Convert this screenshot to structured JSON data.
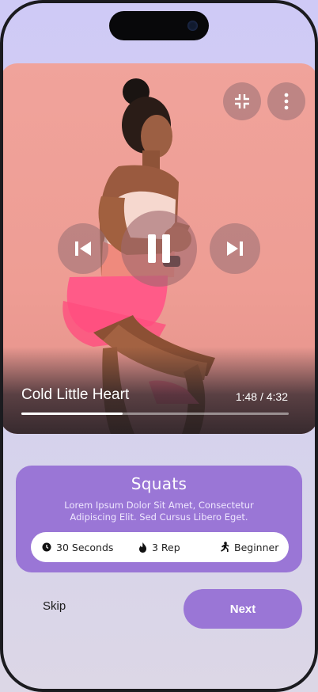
{
  "player": {
    "track_title": "Cold Little Heart",
    "time": "1:48 / 4:32",
    "progress": 0.38,
    "controls": {
      "minimize_icon": "minimize-icon",
      "more_icon": "more-vertical-icon",
      "previous_icon": "skip-previous-icon",
      "pause_icon": "pause-icon",
      "next_icon": "skip-next-icon"
    }
  },
  "exercise": {
    "title": "Squats",
    "description": "Lorem Ipsum Dolor Sit Amet, Consectetur Adipiscing Elit. Sed Cursus Libero Eget.",
    "stats": [
      {
        "icon": "clock-icon",
        "label": "30 Seconds"
      },
      {
        "icon": "flame-icon",
        "label": "3 Rep"
      },
      {
        "icon": "running-icon",
        "label": "Beginner"
      }
    ]
  },
  "actions": {
    "skip_label": "Skip",
    "next_label": "Next"
  },
  "colors": {
    "accent": "#9a76d6",
    "background": "#d2d0ef",
    "video_bg": "#ee9d94"
  }
}
